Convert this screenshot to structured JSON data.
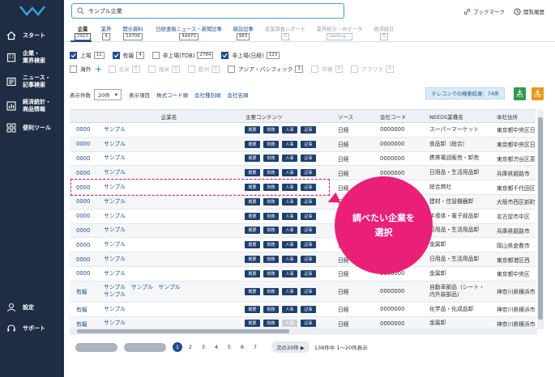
{
  "search": {
    "value": "サンプル企業"
  },
  "header": {
    "bookmark": "ブックマーク",
    "history": "閲覧履歴"
  },
  "sidebar": {
    "items": [
      {
        "label": "スタート",
        "icon": "home-icon"
      },
      {
        "label": "企業・\n業界検索",
        "icon": "building-icon"
      },
      {
        "label": "ニュース・\n記事検索",
        "icon": "newspaper-icon"
      },
      {
        "label": "経済統計・\n商品情報",
        "icon": "bar-chart-icon"
      },
      {
        "label": "便利ツール",
        "icon": "grid-icon"
      }
    ],
    "settings": "設定",
    "support": "サポート"
  },
  "tabs": [
    {
      "label": "企業",
      "count": "2923"
    },
    {
      "label": "業界",
      "count": "4"
    },
    {
      "label": "開示資料",
      "count": "14706"
    },
    {
      "label": "日経速報ニュース・新聞記事",
      "count": "44473"
    },
    {
      "label": "雑誌記事",
      "count": "983"
    },
    {
      "label": "産業調査レポート",
      "count": "0"
    },
    {
      "label": "業界統計・IRデータ",
      "count": "loading..."
    },
    {
      "label": "経済統計",
      "count": "0"
    }
  ],
  "filters": {
    "row1": [
      {
        "label": "上場",
        "count": "11",
        "checked": true
      },
      {
        "label": "有報",
        "count": "4",
        "checked": true
      },
      {
        "label": "非上場(TDB)",
        "count": "2784",
        "checked": false
      },
      {
        "label": "非上場(日経)",
        "count": "123",
        "checked": true
      }
    ],
    "row2": [
      {
        "label": "海外",
        "checked": false
      },
      {
        "label": "北米",
        "count": "0"
      },
      {
        "label": "南米",
        "count": "0"
      },
      {
        "label": "欧州",
        "count": "0"
      },
      {
        "label": "アジア・パシフィック",
        "count": "1"
      },
      {
        "label": "中東",
        "count": "0"
      },
      {
        "label": "アフリカ",
        "count": "0"
      }
    ]
  },
  "toolbar": {
    "display_count_label": "表示件数",
    "display_count_value": "20件",
    "display_items_label": "表示項目",
    "link1": "株式コード順",
    "link2": "会社種別順",
    "link3": "会社名順",
    "telecon": "テレコンでの検索結果：74件",
    "xls": "XLS",
    "csv": "CSV"
  },
  "table": {
    "headers": [
      "",
      "企業名",
      "主要コンテンツ",
      "ソース",
      "会社コード",
      "NEEDS業種名",
      "本社住所"
    ],
    "buttons": [
      "概要",
      "財務",
      "人事",
      "記事"
    ],
    "rows": [
      {
        "code": "0000",
        "name": "サンプル",
        "source": "日経",
        "cc": "0000000",
        "industry": "スーパーマーケット",
        "addr": "東京都中央区日"
      },
      {
        "code": "0000",
        "name": "サンプル",
        "source": "日経",
        "cc": "0000000",
        "industry": "食品卸（総合）",
        "addr": "東京都中央区日"
      },
      {
        "code": "0000",
        "name": "サンプル",
        "source": "日経",
        "cc": "0000000",
        "industry": "携帯電話販売・卸売",
        "addr": "東京都渋谷区恵"
      },
      {
        "code": "0000",
        "name": "サンプル",
        "source": "日経",
        "cc": "0000000",
        "industry": "日用品・生活用品卸",
        "addr": "兵庫県姫路市"
      },
      {
        "code": "0000",
        "name": "サンプル",
        "source": "日経",
        "cc": "0000000",
        "industry": "総合商社",
        "addr": "東京都千代田区"
      },
      {
        "code": "0000",
        "name": "サンプル",
        "source": "日経",
        "cc": "0000000",
        "industry": "建材・住設機器卸",
        "addr": "大阪市西区新町"
      },
      {
        "code": "0000",
        "name": "サンプル",
        "source": "日経",
        "cc": "0000000",
        "industry": "半導体・電子部品卸",
        "addr": "名古屋市中区"
      },
      {
        "code": "0000",
        "name": "サンプル",
        "source": "日経",
        "cc": "0000000",
        "industry": "日用品・生活用品卸",
        "addr": "兵庫県姫路市"
      },
      {
        "code": "0000",
        "name": "サンプル",
        "source": "日経",
        "cc": "0000000",
        "industry": "金属卸",
        "addr": "岡山県倉敷市"
      },
      {
        "code": "0000",
        "name": "サンプル",
        "source": "日経",
        "cc": "0000000",
        "industry": "日用品・生活用品卸",
        "addr": "東京都港区西"
      },
      {
        "code": "0000",
        "name": "サンプル",
        "source": "日経",
        "cc": "0000000",
        "industry": "金属卸",
        "addr": "東京都中央区"
      },
      {
        "code": "有報",
        "name": "サンプル　サンプル　サンプル\nサンプル",
        "source": "日経",
        "cc": "0000000",
        "industry": "自動車部品（シート・\n内外装部品）",
        "addr": "神奈川県横浜市"
      },
      {
        "code": "有報",
        "name": "サンプル",
        "source": "日経",
        "cc": "0000000",
        "industry": "化学品・化成品卸",
        "addr": "神奈川県横浜市"
      },
      {
        "code": "有報",
        "name": "サンプル",
        "source": "日経",
        "cc": "0000000",
        "industry": "金属卸",
        "addr": "神奈川県横浜市"
      }
    ]
  },
  "callout": {
    "line1": "調べたい企業を",
    "line2": "選択"
  },
  "pager": {
    "pages": [
      "1",
      "2",
      "3",
      "4",
      "5",
      "6",
      "7"
    ],
    "next": "次の20件 ▶",
    "info": "138件中 1〜20件表示"
  }
}
